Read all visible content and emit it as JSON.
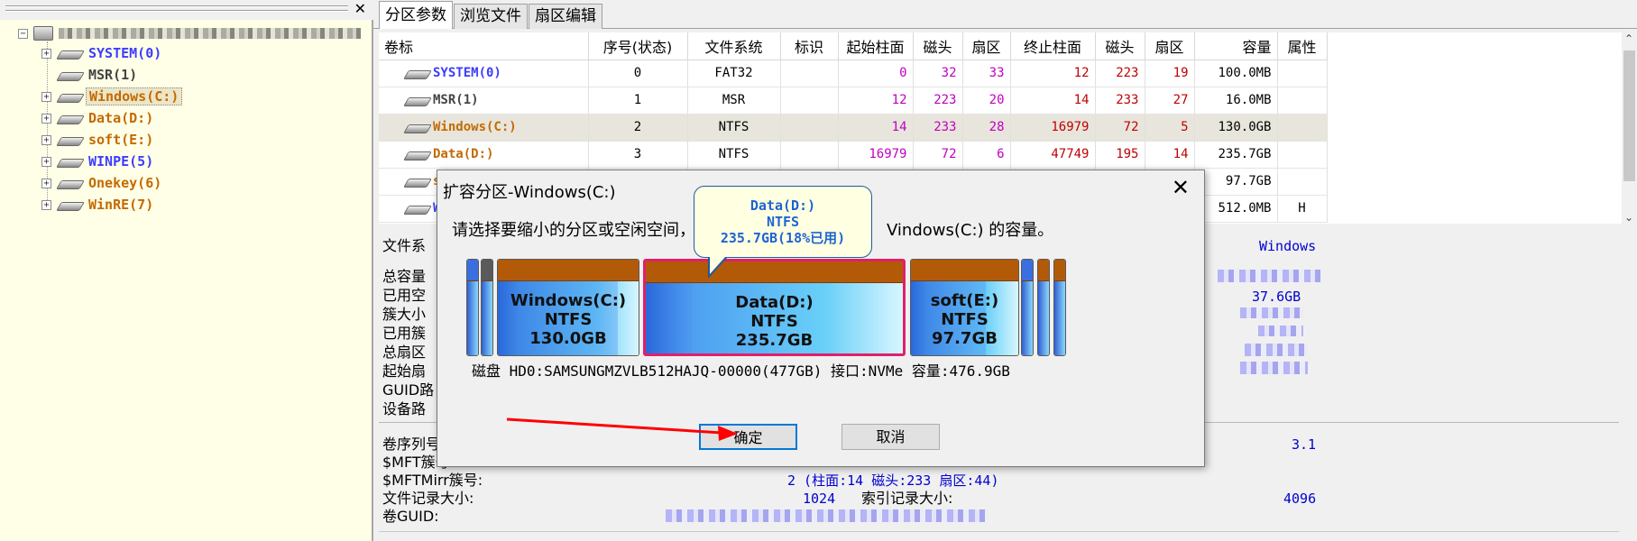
{
  "tree": {
    "root_label": "",
    "items": [
      {
        "label": "SYSTEM(0)",
        "color": "#3c3cff",
        "expandable": true,
        "selected": false
      },
      {
        "label": "MSR(1)",
        "color": "#444444",
        "expandable": false,
        "selected": false
      },
      {
        "label": "Windows(C:)",
        "color": "#c46a00",
        "expandable": true,
        "selected": true
      },
      {
        "label": "Data(D:)",
        "color": "#c46a00",
        "expandable": true,
        "selected": false
      },
      {
        "label": "soft(E:)",
        "color": "#c46a00",
        "expandable": true,
        "selected": false
      },
      {
        "label": "WINPE(5)",
        "color": "#3c3cff",
        "expandable": true,
        "selected": false
      },
      {
        "label": "Onekey(6)",
        "color": "#c46a00",
        "expandable": true,
        "selected": false
      },
      {
        "label": "WinRE(7)",
        "color": "#c46a00",
        "expandable": true,
        "selected": false
      }
    ]
  },
  "tabs": [
    "分区参数",
    "浏览文件",
    "扇区编辑"
  ],
  "grid": {
    "headers": [
      "卷标",
      "序号(状态)",
      "文件系统",
      "标识",
      "起始柱面",
      "磁头",
      "扇区",
      "终止柱面",
      "磁头",
      "扇区",
      "容量",
      "属性"
    ],
    "rows": [
      {
        "vol": "SYSTEM(0)",
        "vol_color": "#3c3cff",
        "idx": "0",
        "fs": "FAT32",
        "flag": "",
        "sc": "0",
        "sh": "32",
        "ss": "33",
        "ec": "12",
        "eh": "223",
        "es": "19",
        "cap": "100.0MB",
        "attr": ""
      },
      {
        "vol": "MSR(1)",
        "vol_color": "#444444",
        "idx": "1",
        "fs": "MSR",
        "flag": "",
        "sc": "12",
        "sh": "223",
        "ss": "20",
        "ec": "14",
        "eh": "233",
        "es": "27",
        "cap": "16.0MB",
        "attr": ""
      },
      {
        "vol": "Windows(C:)",
        "vol_color": "#c46a00",
        "idx": "2",
        "fs": "NTFS",
        "flag": "",
        "sc": "14",
        "sh": "233",
        "ss": "28",
        "ec": "16979",
        "eh": "72",
        "es": "5",
        "cap": "130.0GB",
        "attr": ""
      },
      {
        "vol": "Data(D:)",
        "vol_color": "#c46a00",
        "idx": "3",
        "fs": "NTFS",
        "flag": "",
        "sc": "16979",
        "sh": "72",
        "ss": "6",
        "ec": "47749",
        "eh": "195",
        "es": "14",
        "cap": "235.7GB",
        "attr": ""
      },
      {
        "vol": "s",
        "vol_color": "#c46a00",
        "idx": "",
        "fs": "",
        "flag": "",
        "sc": "",
        "sh": "",
        "ss": "",
        "ec": "",
        "eh": "",
        "es": "",
        "cap": "97.7GB",
        "attr": ""
      },
      {
        "vol": "W",
        "vol_color": "#3c3cff",
        "idx": "",
        "fs": "",
        "flag": "",
        "sc": "",
        "sh": "",
        "ss": "",
        "ec": "",
        "eh": "",
        "es": "",
        "cap": "512.0MB",
        "attr": "H"
      }
    ],
    "selected_row": 2
  },
  "details": {
    "labels": [
      "文件系",
      "总容量",
      "已用空",
      "簇大小",
      "已用簇",
      "总扇区",
      "起始扇",
      "GUID路",
      "设备路",
      "卷序列号",
      "$MFT簇号",
      "$MFTMirr簇号:",
      "文件记录大小:",
      "卷GUID:"
    ],
    "fs_value": "Windows",
    "used_value": "37.6GB",
    "serial_value": "3.1",
    "mftmirr_value": "2 (柱面:14 磁头:233 扇区:44)",
    "record_size": "1024",
    "index_label": "索引记录大小:",
    "index_size": "4096"
  },
  "dialog": {
    "title": "扩容分区-Windows(C:)",
    "message": "请选择要缩小的分区或空闲空间，",
    "message_tail": "Vindows(C:) 的容量。",
    "disk_info": "磁盘 HD0:SAMSUNGMZVLB512HAJQ-00000(477GB)  接口:NVMe  容量:476.9GB",
    "ok_label": "确定",
    "cancel_label": "取消",
    "segments": [
      {
        "name": "",
        "fs": "",
        "size": "",
        "kind": "blue"
      },
      {
        "name": "",
        "fs": "",
        "size": "",
        "kind": "gray"
      },
      {
        "name": "Windows(C:)",
        "fs": "NTFS",
        "size": "130.0GB",
        "kind": "part",
        "used_fraction": 0.85
      },
      {
        "name": "Data(D:)",
        "fs": "NTFS",
        "size": "235.7GB",
        "kind": "part",
        "used_fraction": 0.18,
        "selected": true
      },
      {
        "name": "soft(E:)",
        "fs": "NTFS",
        "size": "97.7GB",
        "kind": "part",
        "used_fraction": 0.7
      },
      {
        "name": "",
        "fs": "",
        "size": "",
        "kind": "blue"
      },
      {
        "name": "",
        "fs": "",
        "size": "",
        "kind": "orange"
      },
      {
        "name": "",
        "fs": "",
        "size": "",
        "kind": "orange"
      }
    ]
  },
  "tooltip": {
    "line1": "Data(D:)",
    "line2": "NTFS",
    "line3": "235.7GB(18%已用)"
  },
  "colors": {
    "selection_border": "#e0206a",
    "annotation_arrow": "#ff0000",
    "tree_background": "#ffffe7"
  }
}
